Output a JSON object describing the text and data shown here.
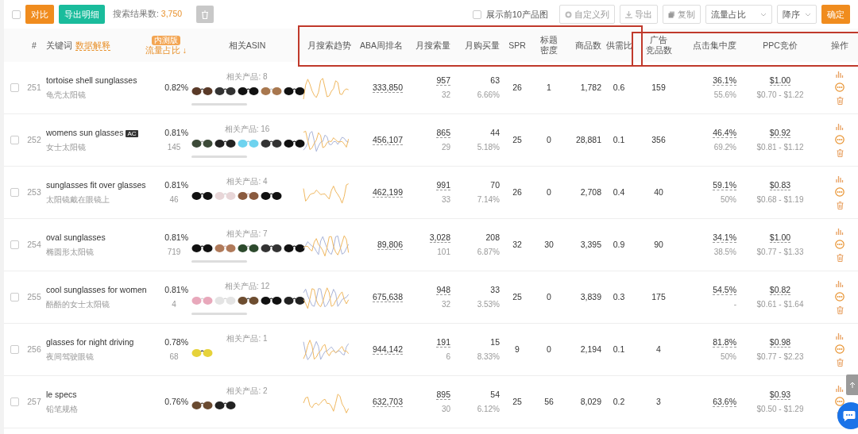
{
  "toolbar": {
    "select_all": {
      "checked": false
    },
    "compare_button": "对比",
    "export_detail_button": "导出明细",
    "result_label": "搜索结果数:",
    "result_count": "3,750",
    "show_top10": {
      "label": "展示前10产品图",
      "checked": false
    },
    "custom_columns_button": "自定义列",
    "export_button": "导出",
    "copy_button": "复制",
    "sort_field": "流量占比",
    "sort_order": "降序",
    "confirm_button": "确定"
  },
  "header": {
    "number": "#",
    "keyword": "关键词",
    "keyword_link": "数据解释",
    "share_badge": "内测版",
    "share": "流量占比",
    "share_sort": "↓",
    "asin": "相关ASIN",
    "trend": "月搜索趋势",
    "aba": "ABA周排名",
    "search": "月搜索量",
    "buy": "月购买量",
    "spr": "SPR",
    "density": [
      "标题",
      "密度"
    ],
    "products": "商品数",
    "ratio": "供需比",
    "ad_count": [
      "广告",
      "竞品数"
    ],
    "click": "点击集中度",
    "ppc": "PPC竞价",
    "action": "操作"
  },
  "rows": [
    {
      "number": "251",
      "checked": false,
      "keyword": "tortoise shell sunglasses",
      "translation": "龟壳太阳镜",
      "share": "0.82%",
      "related": "相关产品: 8",
      "scrollable": true,
      "aba": "333,850",
      "search": "957",
      "search_sub": "32",
      "buy": "63",
      "buy_rate": "6.66%",
      "spr": "26",
      "density": "1",
      "products": "1,782",
      "ratio": "0.6",
      "ad_count": "159",
      "click": "36.1%",
      "click_sub": "55.6%",
      "ppc": "$1.00",
      "ppc_range": "$0.70 - $1.22"
    },
    {
      "number": "252",
      "checked": false,
      "keyword": "womens sun glasses",
      "badge": "AC",
      "translation": "女士太阳镜",
      "share": "0.81%",
      "share_count": "145",
      "related": "相关产品: 16",
      "scrollable": true,
      "aba": "456,107",
      "search": "865",
      "search_sub": "29",
      "buy": "44",
      "buy_rate": "5.18%",
      "spr": "25",
      "density": "0",
      "products": "28,881",
      "ratio": "0.1",
      "ad_count": "356",
      "click": "46.4%",
      "click_sub": "69.2%",
      "ppc": "$0.92",
      "ppc_range": "$0.81 - $1.12"
    },
    {
      "number": "253",
      "checked": false,
      "keyword": "sunglasses fit over glasses",
      "translation": "太阳镜戴在眼镜上",
      "share": "0.81%",
      "share_count": "46",
      "related": "相关产品: 4",
      "scrollable": false,
      "aba": "462,199",
      "search": "991",
      "search_sub": "33",
      "buy": "70",
      "buy_rate": "7.14%",
      "spr": "26",
      "density": "0",
      "products": "2,708",
      "ratio": "0.4",
      "ad_count": "40",
      "click": "59.1%",
      "click_sub": "50%",
      "ppc": "$0.83",
      "ppc_range": "$0.68 - $1.19"
    },
    {
      "number": "254",
      "checked": false,
      "keyword": "oval sunglasses",
      "translation": "椭圆形太阳镜",
      "share": "0.81%",
      "share_count": "719",
      "related": "相关产品: 7",
      "scrollable": true,
      "aba": "89,806",
      "search": "3,028",
      "search_sub": "101",
      "buy": "208",
      "buy_rate": "6.87%",
      "spr": "32",
      "density": "30",
      "products": "3,395",
      "ratio": "0.9",
      "ad_count": "90",
      "click": "34.1%",
      "click_sub": "38.5%",
      "ppc": "$1.00",
      "ppc_range": "$0.77 - $1.33"
    },
    {
      "number": "255",
      "checked": false,
      "keyword": "cool sunglasses for women",
      "translation": "酷酷的女士太阳镜",
      "share": "0.81%",
      "share_count": "4",
      "related": "相关产品: 12",
      "scrollable": true,
      "aba": "675,638",
      "search": "948",
      "search_sub": "32",
      "buy": "33",
      "buy_rate": "3.53%",
      "spr": "25",
      "density": "0",
      "products": "3,839",
      "ratio": "0.3",
      "ad_count": "175",
      "click": "54.5%",
      "click_sub": "-",
      "ppc": "$0.82",
      "ppc_range": "$0.61 - $1.64"
    },
    {
      "number": "256",
      "checked": false,
      "keyword": "glasses for night driving",
      "translation": "夜间驾驶眼镜",
      "share": "0.78%",
      "share_count": "68",
      "related": "相关产品: 1",
      "scrollable": false,
      "aba": "944,142",
      "search": "191",
      "search_sub": "6",
      "buy": "15",
      "buy_rate": "8.33%",
      "spr": "9",
      "density": "0",
      "products": "2,194",
      "ratio": "0.1",
      "ad_count": "4",
      "click": "81.8%",
      "click_sub": "50%",
      "ppc": "$0.98",
      "ppc_range": "$0.77 - $2.23"
    },
    {
      "number": "257",
      "checked": false,
      "keyword": "le specs",
      "translation": "铅笔规格",
      "share": "0.76%",
      "related": "相关产品: 2",
      "scrollable": false,
      "aba": "632,703",
      "search": "895",
      "search_sub": "30",
      "buy": "54",
      "buy_rate": "6.12%",
      "spr": "25",
      "density": "56",
      "products": "8,029",
      "ratio": "0.2",
      "ad_count": "3",
      "click": "63.6%",
      "ppc": "$0.93",
      "ppc_range": "$0.50 - $1.29"
    }
  ]
}
